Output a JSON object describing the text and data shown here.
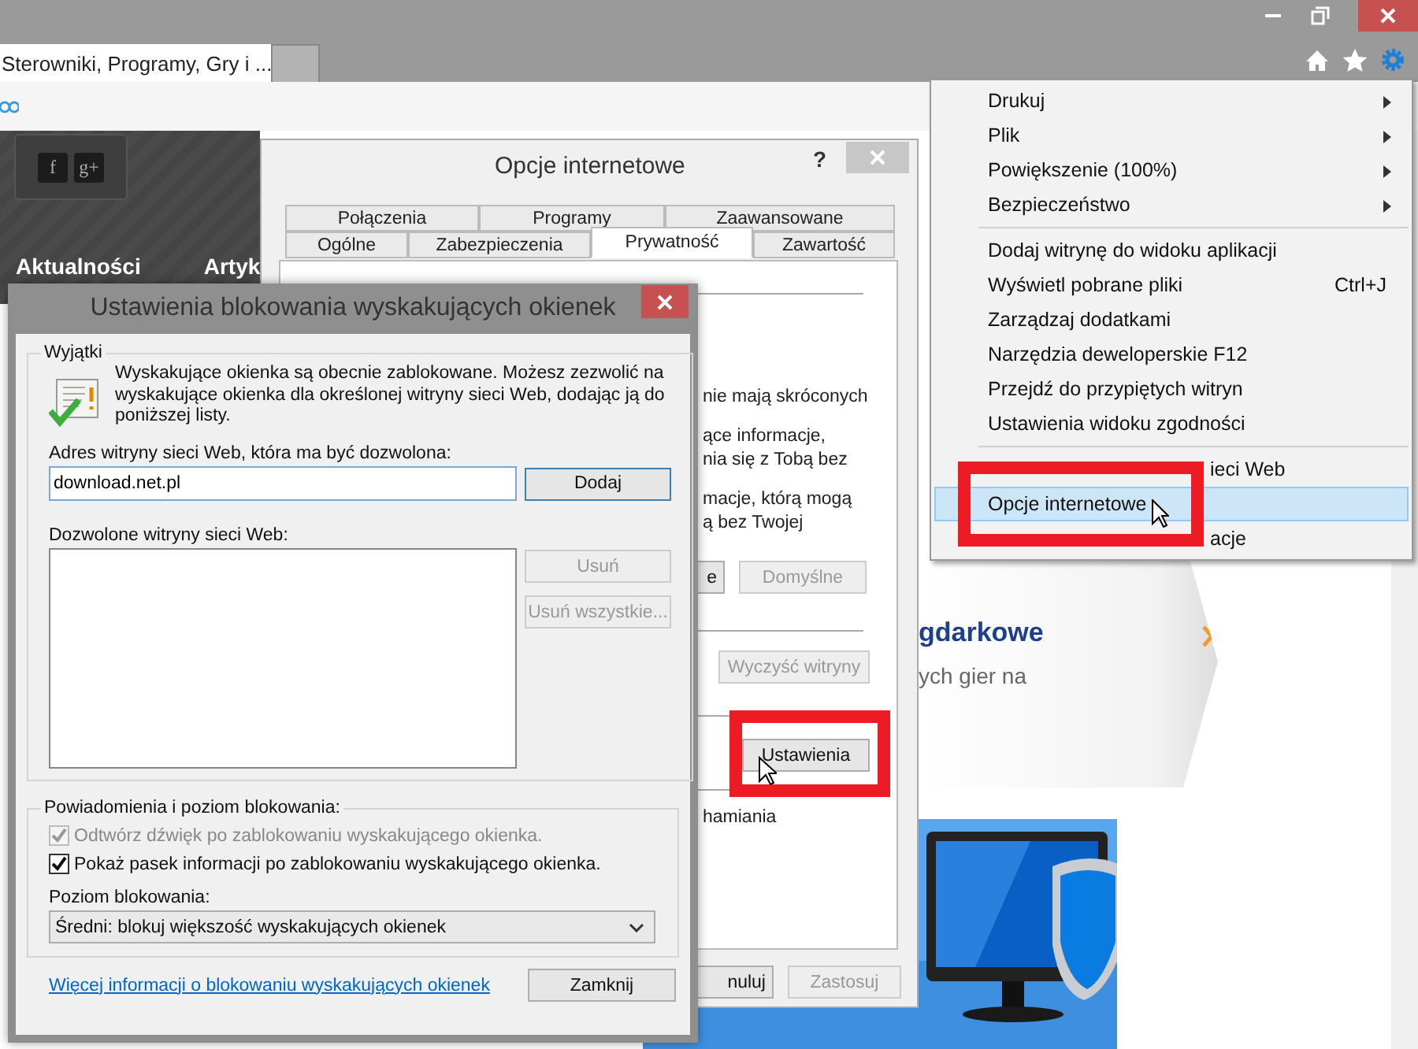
{
  "browser": {
    "tabs": [
      {
        "label": "Sterowniki, Programy, Gry i ...",
        "selected": true
      }
    ],
    "page": {
      "social": [
        "f",
        "g+"
      ],
      "nav": [
        "Aktualności",
        "Artyk"
      ],
      "promo_title": "gdarkowe",
      "promo_text": "ych gier na"
    }
  },
  "menu": {
    "groups": [
      [
        {
          "label": "Drukuj",
          "kind": "submenu",
          "selected": false
        },
        {
          "label": "Plik",
          "kind": "submenu",
          "selected": false
        },
        {
          "label": "Powiększenie (100%)",
          "kind": "submenu",
          "selected": false
        },
        {
          "label": "Bezpieczeństwo",
          "kind": "submenu",
          "selected": false
        }
      ],
      [
        {
          "label": "Dodaj witrynę do widoku aplikacji",
          "kind": "plain",
          "selected": false
        },
        {
          "label": "Wyświetl pobrane pliki",
          "kind": "plain",
          "shortcut": "Ctrl+J",
          "selected": false
        },
        {
          "label": "Zarządzaj dodatkami",
          "kind": "plain",
          "selected": false
        },
        {
          "label": "Narzędzia deweloperskie F12",
          "kind": "plain",
          "selected": false
        },
        {
          "label": "Przejdź do przypiętych witryn",
          "kind": "plain",
          "selected": false
        },
        {
          "label": "Ustawienia widoku zgodności",
          "kind": "plain",
          "selected": false
        }
      ],
      [
        {
          "label": "ieci Web",
          "kind": "covered",
          "selected": false
        },
        {
          "label": "Opcje internetowe",
          "kind": "plain",
          "selected": true
        },
        {
          "label": "acje",
          "kind": "covered",
          "selected": false
        }
      ]
    ]
  },
  "options_dialog": {
    "title": "Opcje internetowe",
    "help": "?",
    "tab_rows": [
      [
        {
          "label": "Połączenia",
          "selected": false
        },
        {
          "label": "Programy",
          "selected": false
        },
        {
          "label": "Zaawansowane",
          "selected": false
        }
      ],
      [
        {
          "label": "Ogólne",
          "selected": false
        },
        {
          "label": "Zabezpieczenia",
          "selected": false
        },
        {
          "label": "Prywatność",
          "selected": true
        },
        {
          "label": "Zawartość",
          "selected": false
        }
      ]
    ],
    "text_lines": [
      "nie mają skróconych",
      "ące informacje,",
      "nia się z Tobą bez",
      "macje, którą mogą",
      "ą bez Twojej",
      "hamiania"
    ],
    "buttons": [
      {
        "label": "e",
        "disabled": false,
        "highlighted": false
      },
      {
        "label": "Domyślne",
        "disabled": true,
        "highlighted": false
      },
      {
        "label": "Wyczyść witryny",
        "disabled": true,
        "highlighted": false
      },
      {
        "label": "Ustawienia",
        "disabled": false,
        "highlighted": true
      },
      {
        "label": "nuluj",
        "disabled": false,
        "highlighted": false
      },
      {
        "label": "Zastosuj",
        "disabled": true,
        "highlighted": false
      }
    ]
  },
  "popup": {
    "title": "Ustawienia blokowania wyskakujących okienek",
    "exceptions": {
      "legend": "Wyjątki",
      "message": "Wyskakujące okienka są obecnie zablokowane. Możesz zezwolić na wyskakujące okienka dla określonej witryny sieci Web, dodając ją do poniższej listy.",
      "address_label": "Adres witryny sieci Web, która ma być dozwolona:",
      "address_value": "download.net.pl",
      "add_button": "Dodaj",
      "allowed_label": "Dozwolone witryny sieci Web:",
      "remove_buttons": [
        {
          "label": "Usuń",
          "disabled": true
        },
        {
          "label": "Usuń wszystkie...",
          "disabled": true
        }
      ]
    },
    "notifications": {
      "legend": "Powiadomienia i poziom blokowania:",
      "options": [
        {
          "label": "Odtwórz dźwięk po zablokowaniu wyskakującego okienka.",
          "checked": true,
          "disabled": true
        },
        {
          "label": "Pokaż pasek informacji po zablokowaniu wyskakującego okienka.",
          "checked": true,
          "disabled": false
        }
      ],
      "level_label": "Poziom blokowania:",
      "level_value": "Średni: blokuj większość wyskakujących okienek"
    },
    "link": "Więcej informacji o blokowaniu wyskakujących okienek",
    "close_button": "Zamknij"
  }
}
